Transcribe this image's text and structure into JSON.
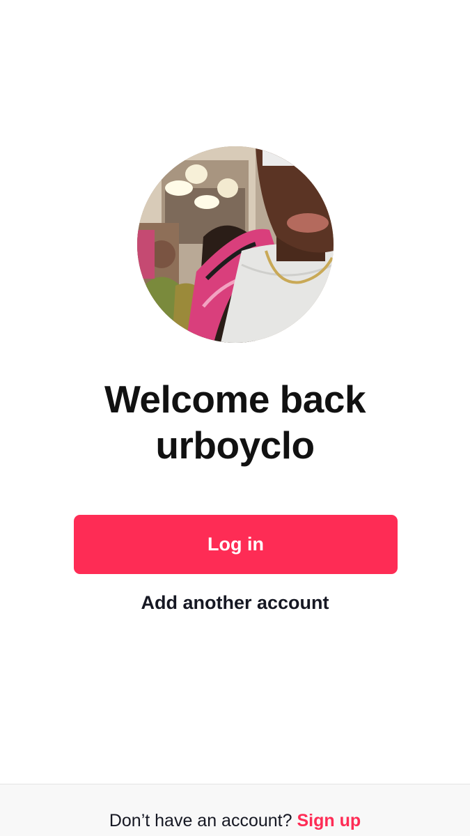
{
  "profile": {
    "username": "urboyclo",
    "avatar_icon": "profile-photo"
  },
  "welcome": {
    "line1": "Welcome back",
    "line2": "urboyclo"
  },
  "actions": {
    "login_label": "Log in",
    "add_account_label": "Add another account"
  },
  "footer": {
    "prompt": "Don’t have an account?",
    "signup_label": "Sign up"
  },
  "colors": {
    "accent": "#fe2c55",
    "text": "#161823",
    "background": "#ffffff",
    "footer_background": "#f8f8f8"
  }
}
